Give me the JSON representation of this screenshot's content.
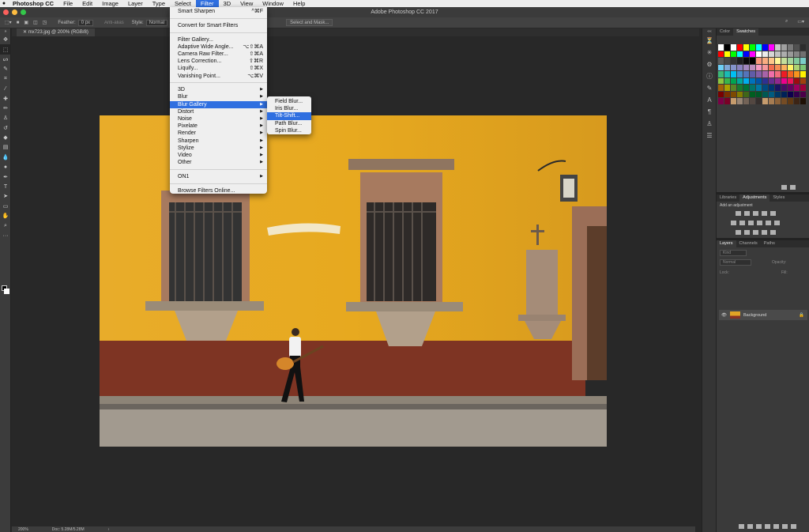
{
  "menubar": {
    "apple": "",
    "items": [
      "Photoshop CC",
      "File",
      "Edit",
      "Image",
      "Layer",
      "Type",
      "Select",
      "Filter",
      "3D",
      "View",
      "Window",
      "Help"
    ]
  },
  "titlebar": {
    "title": "Adobe Photoshop CC 2017"
  },
  "optbar": {
    "feather_label": "Feather:",
    "feather_value": "0 px",
    "antialias_label": "Anti-alias",
    "style_label": "Style:",
    "style_value": "Normal",
    "select_mask_label": "Select and Mask..."
  },
  "document": {
    "tab_label": "mx723.jpg @ 200% (RGB/8)"
  },
  "status": {
    "zoom": "200%",
    "doc_size": "Doc: 5.28M/5.28M"
  },
  "filter_menu": {
    "items": [
      {
        "label": "Smart Sharpen",
        "shortcut": "^⌘F"
      },
      {
        "sep": true
      },
      {
        "label": "Convert for Smart Filters"
      },
      {
        "sep": true
      },
      {
        "label": "Filter Gallery..."
      },
      {
        "label": "Adaptive Wide Angle...",
        "shortcut": "⌥⇧⌘A"
      },
      {
        "label": "Camera Raw Filter...",
        "shortcut": "⇧⌘A"
      },
      {
        "label": "Lens Correction...",
        "shortcut": "⇧⌘R"
      },
      {
        "label": "Liquify...",
        "shortcut": "⇧⌘X"
      },
      {
        "label": "Vanishing Point...",
        "shortcut": "⌥⌘V"
      },
      {
        "sep": true
      },
      {
        "label": "3D",
        "arrow": true
      },
      {
        "label": "Blur",
        "arrow": true
      },
      {
        "label": "Blur Gallery",
        "arrow": true,
        "highlight": true
      },
      {
        "label": "Distort",
        "arrow": true
      },
      {
        "label": "Noise",
        "arrow": true
      },
      {
        "label": "Pixelate",
        "arrow": true
      },
      {
        "label": "Render",
        "arrow": true
      },
      {
        "label": "Sharpen",
        "arrow": true
      },
      {
        "label": "Stylize",
        "arrow": true
      },
      {
        "label": "Video",
        "arrow": true
      },
      {
        "label": "Other",
        "arrow": true
      },
      {
        "sep": true
      },
      {
        "label": "ON1",
        "arrow": true
      },
      {
        "sep": true
      },
      {
        "label": "Browse Filters Online..."
      }
    ]
  },
  "blur_gallery_submenu": {
    "items": [
      {
        "label": "Field Blur..."
      },
      {
        "label": "Iris Blur..."
      },
      {
        "label": "Tilt-Shift...",
        "highlight": true
      },
      {
        "label": "Path Blur..."
      },
      {
        "label": "Spin Blur..."
      }
    ]
  },
  "panels": {
    "color_tabs": [
      "Color",
      "Swatches"
    ],
    "mid_tabs": [
      "Libraries",
      "Adjustments",
      "Styles"
    ],
    "add_adjustment": "Add an adjustment",
    "layer_tabs": [
      "Layers",
      "Channels",
      "Paths"
    ],
    "kind_placeholder": "Kind",
    "blend_mode": "Normal",
    "opacity_label": "Opacity:",
    "lock_label": "Lock:",
    "fill_label": "Fill:",
    "layer_name": "Background"
  },
  "swatches": [
    "#ffffff",
    "#000000",
    "#ffffff",
    "#ff0000",
    "#ffff00",
    "#00ff00",
    "#00ffff",
    "#0000ff",
    "#ff00ff",
    "#c8c8c8",
    "#a0a0a0",
    "#787878",
    "#505050",
    "#2d2d2d",
    "#ff0000",
    "#ffff00",
    "#00ff00",
    "#00ffff",
    "#0000ff",
    "#ff00ff",
    "#ffffff",
    "#ebebeb",
    "#d6d6d6",
    "#c2c2c2",
    "#adadad",
    "#999999",
    "#858585",
    "#707070",
    "#5c5c5c",
    "#474747",
    "#333333",
    "#1f1f1f",
    "#0a0a0a",
    "#000000",
    "#f7977a",
    "#f9ad81",
    "#fdc68a",
    "#fff79a",
    "#c4df9b",
    "#a3d39c",
    "#82ca9d",
    "#7bcdc8",
    "#6ecff6",
    "#7ea7d8",
    "#8493ca",
    "#8882be",
    "#a187be",
    "#bc8dbf",
    "#f49ac2",
    "#f6989d",
    "#f26c4f",
    "#f68e55",
    "#fbaf5c",
    "#fff467",
    "#acd372",
    "#7cc576",
    "#3bb878",
    "#1abbb4",
    "#00bff3",
    "#438cca",
    "#5574b9",
    "#605ca8",
    "#855fa8",
    "#a763a8",
    "#f06ea9",
    "#f26d7d",
    "#ed1c24",
    "#f26522",
    "#f7941d",
    "#fff200",
    "#8dc63f",
    "#39b54a",
    "#00a651",
    "#00a99d",
    "#00aeef",
    "#0072bc",
    "#0054a6",
    "#2e3192",
    "#662d91",
    "#92278f",
    "#ec008c",
    "#ed145b",
    "#9e0b0f",
    "#a0410d",
    "#a36209",
    "#aba000",
    "#598527",
    "#197b30",
    "#007236",
    "#00746b",
    "#0076a3",
    "#004a80",
    "#003471",
    "#1b1464",
    "#440e62",
    "#630460",
    "#9e005d",
    "#9e0039",
    "#790000",
    "#7b2e00",
    "#7d4900",
    "#827b00",
    "#406618",
    "#005e20",
    "#005826",
    "#005952",
    "#005b7f",
    "#003663",
    "#002157",
    "#0d004c",
    "#32004b",
    "#4b0049",
    "#7b0046",
    "#7a0026",
    "#c69c6d",
    "#998675",
    "#736357",
    "#534741",
    "#362f2d",
    "#c69c6d",
    "#a67c52",
    "#8c6239",
    "#754c24",
    "#603913",
    "#3c2415",
    "#1e1005"
  ]
}
